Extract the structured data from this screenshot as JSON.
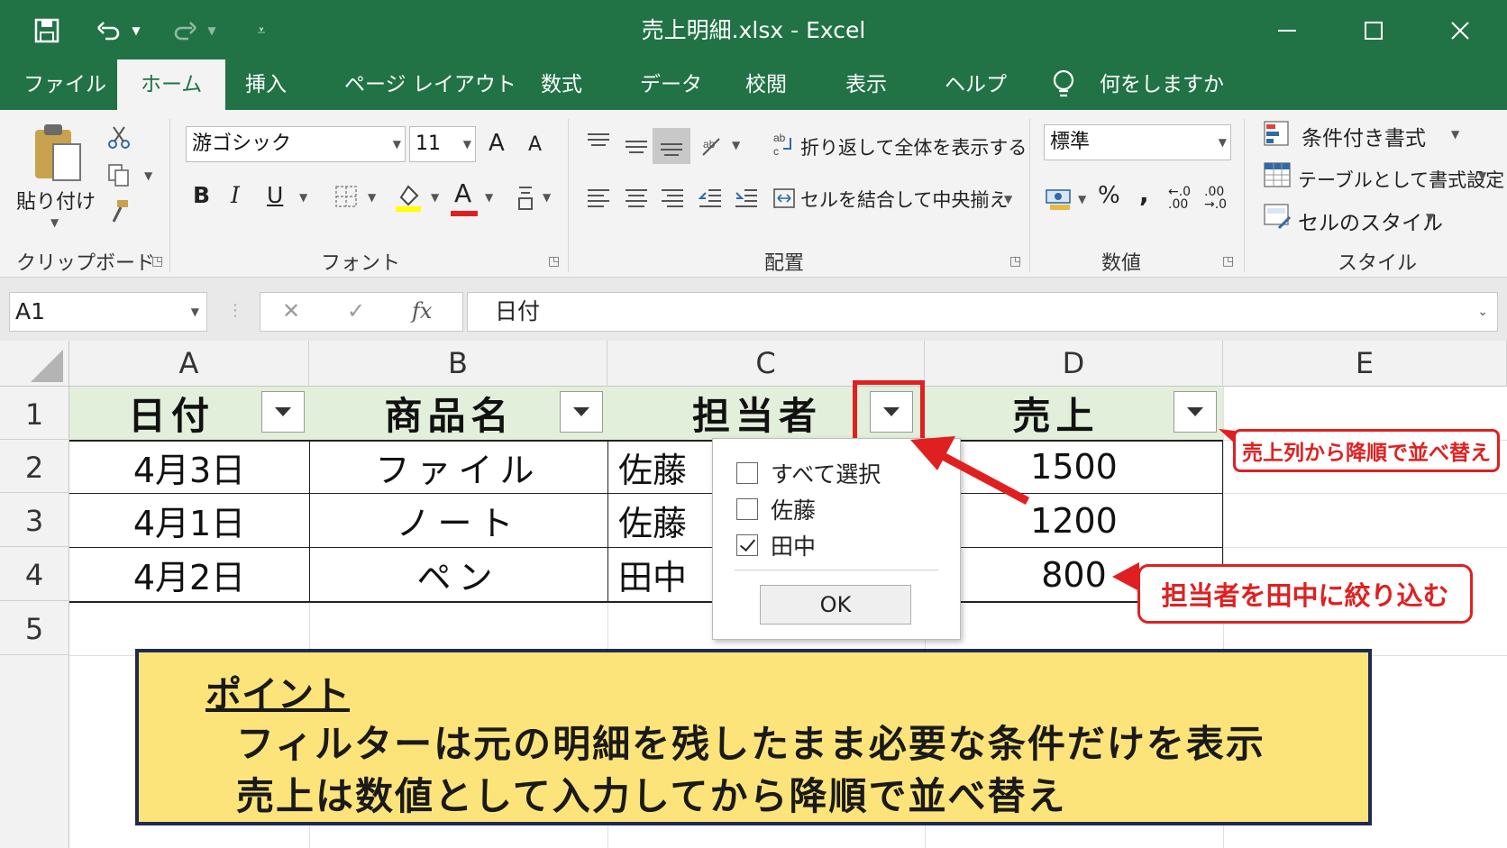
{
  "window": {
    "title": "売上明細.xlsx  -  Excel"
  },
  "tabs": [
    "ファイル",
    "ホーム",
    "挿入",
    "ページ レイアウト",
    "数式",
    "データ",
    "校閲",
    "表示",
    "ヘルプ"
  ],
  "active_tab": "ホーム",
  "tell_me": "何をしますか",
  "ribbon": {
    "clipboard": {
      "paste_label": "貼り付け",
      "group_label": "クリップボード"
    },
    "font": {
      "font_name": "游ゴシック",
      "font_size": "11",
      "bold": "B",
      "italic": "I",
      "underline": "U",
      "grow": "A",
      "shrink": "A",
      "font_color": "A",
      "group_label": "フォント"
    },
    "alignment": {
      "wrap_text": "折り返して全体を表示する",
      "merge_center": "セルを結合して中央揃え",
      "group_label": "配置"
    },
    "number": {
      "format": "標準",
      "percent": "%",
      "comma": ",",
      "inc_decimal": "←.0 .00",
      "dec_decimal": ".00 →.0",
      "group_label": "数値"
    },
    "styles": {
      "conditional": "条件付き書式",
      "as_table": "テーブルとして書式設定",
      "cell_styles": "セルのスタイル",
      "group_label": "スタイル"
    }
  },
  "formula_bar": {
    "name_box": "A1",
    "fx": "fx",
    "formula": "日付"
  },
  "sheet": {
    "columns": [
      "A",
      "B",
      "C",
      "D",
      "E"
    ],
    "rows": [
      "1",
      "2",
      "3",
      "4",
      "5"
    ],
    "header_cells": [
      "日付",
      "商品名",
      "担当者",
      "売上"
    ],
    "data_rows": [
      [
        "4月3日",
        "ファイル",
        "佐藤",
        "1500"
      ],
      [
        "4月1日",
        "ノート",
        "佐藤",
        "1200"
      ],
      [
        "4月2日",
        "ペン",
        "田中",
        "800"
      ]
    ]
  },
  "filter_dropdown": {
    "items": [
      {
        "label": "すべて選択",
        "checked": false
      },
      {
        "label": "佐藤",
        "checked": false
      },
      {
        "label": "田中",
        "checked": true
      }
    ],
    "ok_label": "OK"
  },
  "callouts": {
    "sort": "売上列から降順で並べ替え",
    "filter": "担当者を田中に絞り込む"
  },
  "point": {
    "title": "ポイント",
    "line1": "フィルターは元の明細を残したまま必要な条件だけを表示",
    "line2": "売上は数値として入力してから降順で並べ替え"
  },
  "colors": {
    "excel_green": "#217346",
    "header_fill": "#e2efda",
    "callout_red": "#e02020",
    "point_fill": "#fde47a",
    "point_border": "#1f2a52"
  }
}
